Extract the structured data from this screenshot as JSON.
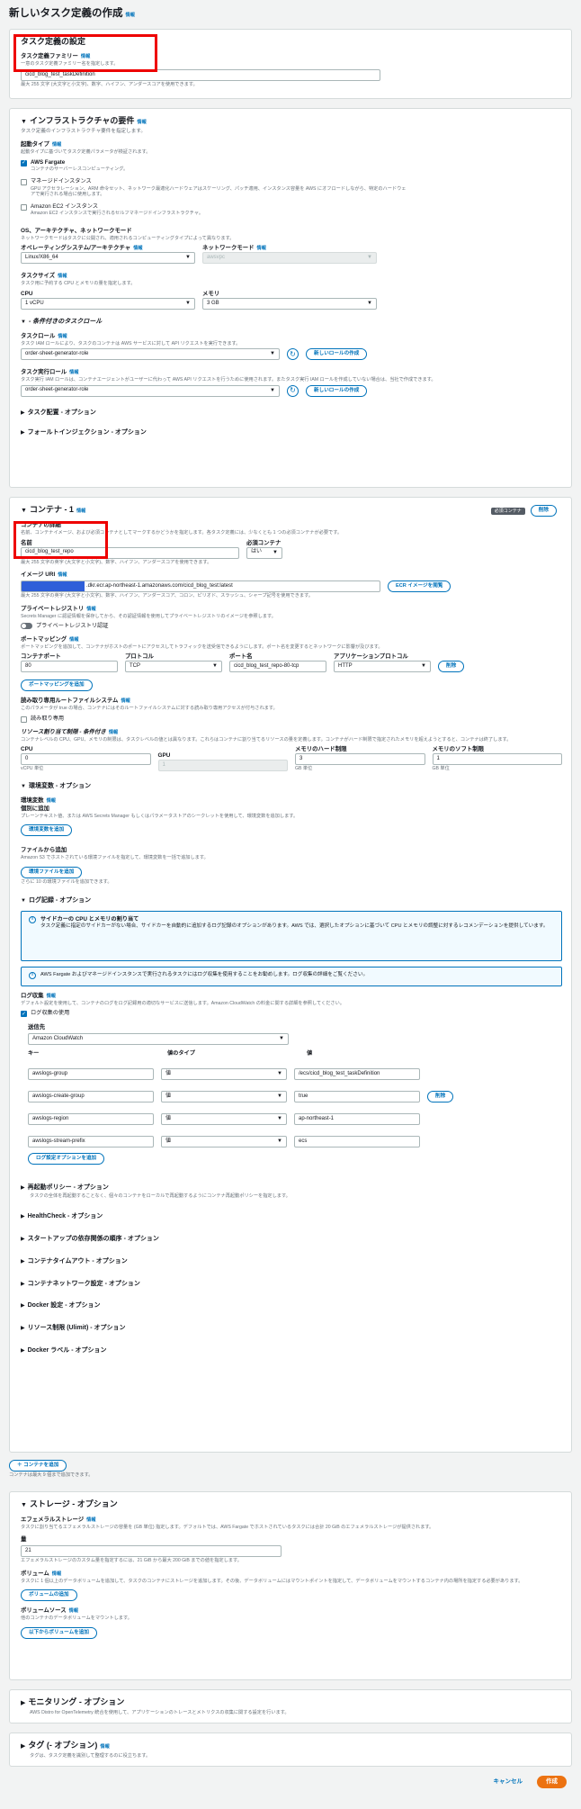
{
  "page_title": "新しいタスク定義の作成",
  "info": "情報",
  "config": {
    "title": "タスク定義の設定",
    "family_label": "タスク定義ファミリー",
    "family_desc": "一意のタスク定義ファミリー名を指定します。",
    "family_value": "cicd_blog_test_taskDefinition",
    "family_hint": "最大 255 文字 (大文字と小文字)、数字、ハイフン、アンダースコアを使用できます。"
  },
  "infra": {
    "title": "インフラストラクチャの要件",
    "desc": "タスク定義のインフラストラクチャ要件を指定します。",
    "launch_label": "起動タイプ",
    "launch_desc": "起動タイプに基づいてタスク定義パラメータが検証されます。",
    "fargate": "AWS Fargate",
    "fargate_desc": "コンテナのサーバーレスコンピューティング。",
    "managed": "マネージドインスタンス",
    "managed_desc": "GPU アクセラレーション、ARM 命令セット、ネットワーク最適化ハードウェアはスケーリング、パッチ適用、インスタンス容量を AWS にオフロードしながら、特定のハードウェアで実行される場合に使用します。",
    "ec2": "Amazon EC2 インスタンス",
    "ec2_desc": "Amazon EC2 インスタンスで実行されるセルフマネージドインフラストラクチャ。",
    "os_section": "OS、アーキテクチャ、ネットワークモード",
    "os_section_desc": "ネットワークモードはタスクに公開され、適用されるコンピューティングタイプによって異なります。",
    "os_label": "オペレーティングシステム/アーキテクチャ",
    "os_value": "Linux/X86_64",
    "net_label": "ネットワークモード",
    "net_value": "awsvpc",
    "size_label": "タスクサイズ",
    "size_desc": "タスク用に予約する CPU とメモリの量を指定します。",
    "cpu_label": "CPU",
    "cpu_value": "1 vCPU",
    "mem_label": "メモリ",
    "mem_value": "3 GB",
    "roles_header": "- 条件付きのタスクロール",
    "task_role_label": "タスクロール",
    "task_role_desc": "タスク IAM ロールにより、タスクのコンテナは AWS サービスに対して API リクエストを実行できます。",
    "task_role_value": "order-sheet-generator-role",
    "new_role": "新しいロールの作成",
    "exec_role_label": "タスク実行ロール",
    "exec_role_desc": "タスク実行 IAM ロールは、コンテナエージェントがユーザーに代わって AWS API リクエストを行うために使用されます。またタスク実行 IAM ロールを作成していない場合は、当社で作成できます。",
    "exec_role_value": "order-sheet-generator-role",
    "placement": "タスク配置 - オプション",
    "fault": "フォールトインジェクション - オプション"
  },
  "container": {
    "title": "コンテナ - 1",
    "essential_badge": "必須コンテナ",
    "remove": "削除",
    "details": "コンテナの詳細",
    "details_desc": "名前、コンテナイメージ、および必須コンテナとしてマークするかどうかを指定します。各タスク定義には、少なくとも 1 つの必須コンテナが必要です。",
    "name_label": "名前",
    "name_value": "cicd_blog_test_repo",
    "name_hint": "最大 255 文字の英字 (大文字と小文字)、数字、ハイフン、アンダースコアを使用できます。",
    "essential_label": "必須コンテナ",
    "essential_value": "はい",
    "uri_label": "イメージ URI",
    "uri_value": ".dkr.ecr.ap-northeast-1.amazonaws.com/cicd_blog_test:latest",
    "uri_hint": "最大 255 文字の英字 (大文字と小文字)、数字、ハイフン、アンダースコア、コロン、ピリオド、スラッシュ、シャープ記号を使用できます。",
    "ecr_btn": "ECR イメージを閲覧",
    "registry_label": "プライベートレジストリ",
    "registry_desc": "Secrets Manager に認証情報を保存してから、その認証情報を使用してプライベートレジストリのイメージを参照します。",
    "registry_toggle": "プライベートレジストリ認証",
    "port_label": "ポートマッピング",
    "port_desc": "ポートマッピングを追加して、コンテナがホストのポートにアクセスしてトラフィックを送受信できるようにします。ポート名を変更するとネットワークに影響が及びます。",
    "port_cols": [
      "コンテナポート",
      "プロトコル",
      "ポート名",
      "アプリケーションプロトコル"
    ],
    "port_values": [
      "80",
      "TCP",
      "cicd_blog_test_repo-80-tcp",
      "HTTP"
    ],
    "port_remove": "削除",
    "port_add": "ポートマッピングを追加",
    "ro_label": "読み取り専用ルートファイルシステム",
    "ro_desc": "このパラメータが true の場合、コンテナにはそのルートファイルシステムに対する読み取り専用アクセスが付与されます。",
    "ro_cb": "読み取り専用",
    "limits_label": "リソース割り当て制限 - 条件付き",
    "limits_desc": "コンテナレベルの CPU、GPU、メモリの制限は、タスクレベルの値とは異なります。これらはコンテナに割り当てるリソースの量を定義します。コンテナがハード制限で指定されたメモリを超えようとすると、コンテナは終了します。",
    "limit_cols": [
      "CPU",
      "GPU",
      "メモリのハード制限",
      "メモリのソフト制限"
    ],
    "limit_values": [
      "0",
      "1",
      "3",
      "1"
    ],
    "limit_units": [
      "vCPU 単位",
      "",
      "GB 単位",
      "GB 単位"
    ],
    "env_header": "環境変数 - オプション",
    "env_label": "環境変数",
    "env_sub": "個別に追加",
    "env_desc": "プレーンテキスト値、または AWS Secrets Manager もしくはパラメータストアのシークレットを使用して、環境変数を追加します。",
    "env_add": "環境変数を追加",
    "file_label": "ファイルから追加",
    "file_desc": "Amazon S3 でホストされている環境ファイルを指定して、環境変数を一括で追加します。",
    "file_add": "環境ファイルを追加",
    "file_hint": "さらに 10 の環境ファイルを追加できます。",
    "log_header": "ログ記録 - オプション",
    "alert1_title": "サイドカーの CPU とメモリの割り当て",
    "alert1_desc": "タスク定義に指定のサイドカーがない場合、サイドカーを自動的に追加するログ記録のオプションがあります。AWS では、選択したオプションに基づいて CPU とメモリの調整に対するレコメンデーションを提供しています。",
    "alert2": "AWS Fargate およびマネージドインスタンスで実行されるタスクにはログ収集を使用することをお勧めします。ログ収集の詳細をご覧ください。",
    "log_label": "ログ収集",
    "log_desc": "デフォルト設定を使用して、コンテナのログをログ記録用の適切なサービスに送信します。Amazon CloudWatch の料金に関する詳細を参照してください。",
    "log_cb": "ログ収集の使用",
    "dest_label": "送信先",
    "dest_value": "Amazon CloudWatch",
    "log_cols": [
      "キー",
      "値のタイプ",
      "値"
    ],
    "log_rows": [
      [
        "awslogs-group",
        "値",
        "/ecs/cicd_blog_test_taskDefinition"
      ],
      [
        "awslogs-create-group",
        "値",
        "true"
      ],
      [
        "awslogs-region",
        "値",
        "ap-northeast-1"
      ],
      [
        "awslogs-stream-prefix",
        "値",
        "ecs"
      ]
    ],
    "log_remove": "削除",
    "log_add": "ログ設定オプションを追加",
    "restart": "再起動ポリシー - オプション",
    "restart_desc": "タスクの全体を再起動することなく、個々のコンテナをローカルで再起動するようにコンテナ再起動ポリシーを指定します。",
    "collapsed": [
      "HealthCheck - オプション",
      "スタートアップの依存関係の順序 - オプション",
      "コンテナタイムアウト - オプション",
      "コンテナネットワーク設定 - オプション",
      "Docker 設定 - オプション",
      "リソース制限 (Ulimit) - オプション",
      "Docker ラベル - オプション"
    ]
  },
  "add_container": "コンテナを追加",
  "add_container_hint": "コンテナは最大 9 個まで追加できます。",
  "storage": {
    "title": "ストレージ - オプション",
    "eph_label": "エフェメラルストレージ",
    "eph_desc": "タスクに割り当てるエフェメラルストレージの容量を (GB 単位) 指定します。デフォルトでは、AWS Fargate でホストされているタスクには合計 20 GiB のエフェメラルストレージが提供されます。",
    "amount_label": "量",
    "amount_value": "21",
    "amount_hint": "エフェメラルストレージのカスタム量を指定するには、21 GiB から最大 200 GiB までの値を指定します。",
    "vol_label": "ボリューム",
    "vol_desc": "タスクに 1 個以上のデータボリュームを追加して、タスクのコンテナにストレージを追加します。その後、データボリュームにはマウントポイントを指定して、データボリュームをマウントするコンテナ内の場所を指定する必要があります。",
    "vol_add": "ボリュームの追加",
    "vsrc_label": "ボリュームソース",
    "vsrc_desc": "他のコンテナのデータボリュームをマウントします。",
    "vsrc_add": "以下からボリュームを追加"
  },
  "monitoring": {
    "title": "モニタリング - オプション",
    "desc": "AWS Distro for OpenTelemetry 統合を使用して、アプリケーションのトレースとメトリクスの収集に関する設定を行います。"
  },
  "tags": {
    "title": "タグ (- オプション)",
    "desc": "タグは、タスク定義を識別して整理するのに役立ちます。"
  },
  "footer": {
    "cancel": "キャンセル",
    "create": "作成"
  }
}
